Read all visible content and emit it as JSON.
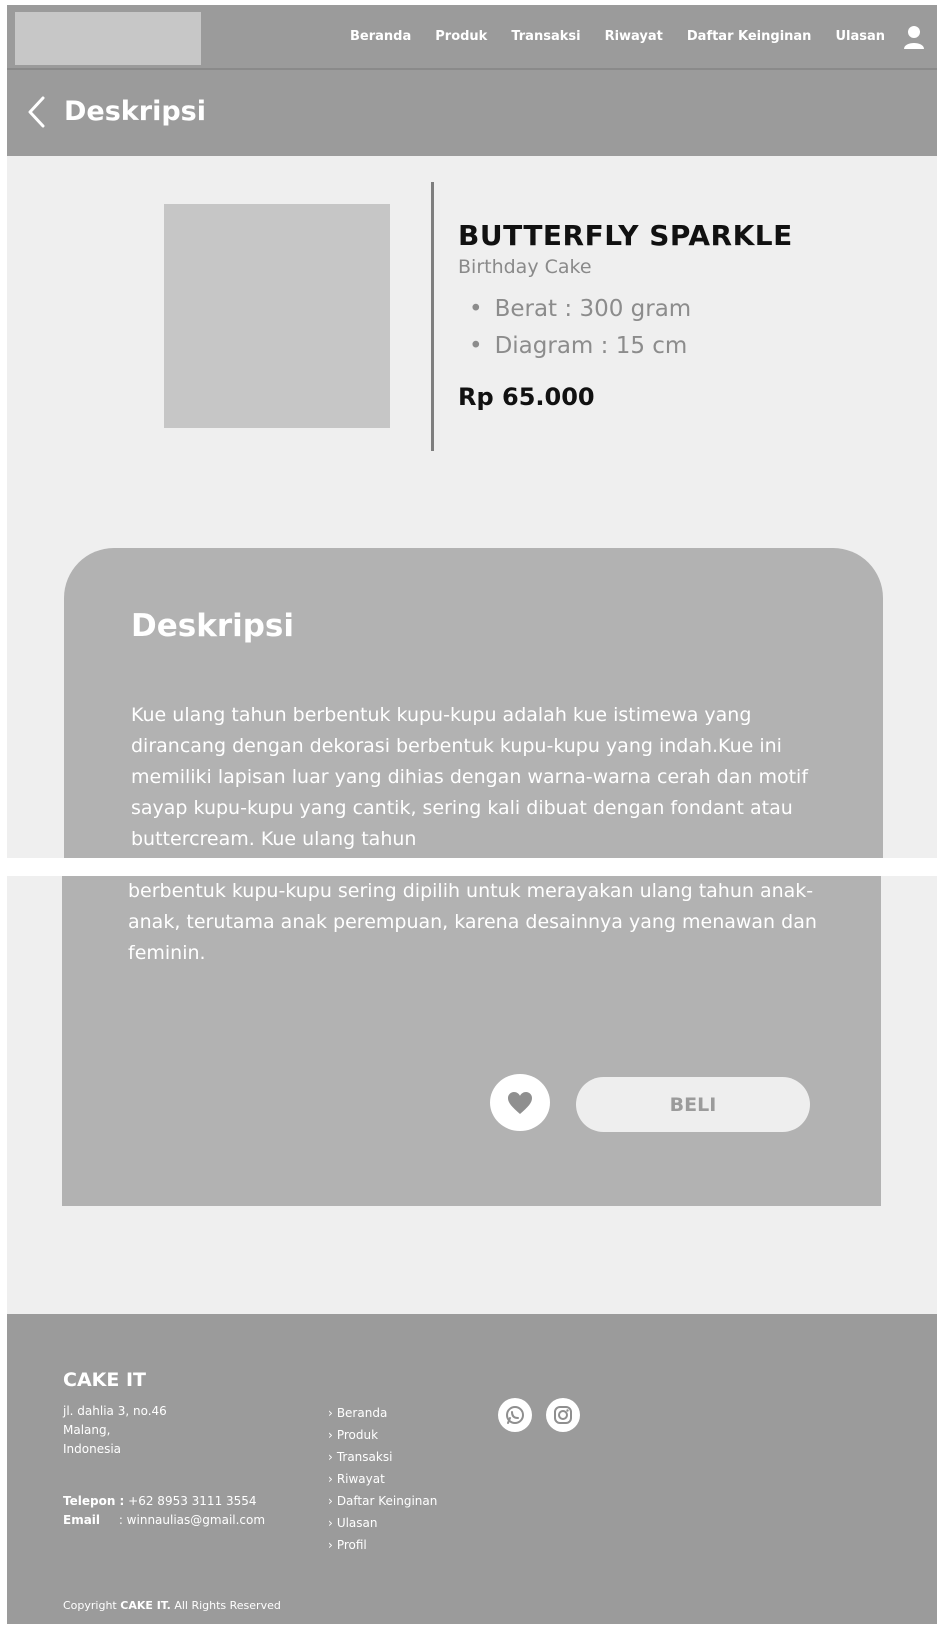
{
  "navbar": {
    "links": [
      "Beranda",
      "Produk",
      "Transaksi",
      "Riwayat",
      "Daftar Keinginan",
      "Ulasan"
    ]
  },
  "header": {
    "title": "Deskripsi"
  },
  "product": {
    "name": "BUTTERFLY SPARKLE",
    "category": "Birthday Cake",
    "specs": [
      "Berat : 300 gram",
      "Diagram : 15 cm"
    ],
    "price": "Rp 65.000"
  },
  "description": {
    "title": "Deskripsi",
    "text_part1": "Kue ulang tahun berbentuk kupu-kupu adalah kue istimewa yang dirancang dengan dekorasi berbentuk kupu-kupu yang indah.Kue ini memiliki lapisan luar yang dihias dengan warna-warna cerah dan motif sayap kupu-kupu yang cantik, sering kali dibuat dengan fondant atau buttercream. Kue ulang tahun",
    "text_part2": "berbentuk kupu-kupu sering dipilih untuk merayakan ulang tahun anak-anak, terutama anak perempuan, karena desainnya yang menawan dan feminin.",
    "buy_label": "BELI"
  },
  "footer": {
    "brand": "CAKE IT",
    "address": [
      "jl. dahlia 3, no.46",
      "Malang,",
      "Indonesia"
    ],
    "phone_label": "Telepon :",
    "phone": "+62 8953 3111 3554",
    "email_label": "Email",
    "email": ": winnaulias@gmail.com",
    "links": [
      "Beranda",
      "Produk",
      "Transaksi",
      "Riwayat",
      "Daftar Keinginan",
      "Ulasan",
      "Profil"
    ],
    "copyright_prefix": "Copyright",
    "copyright_brand": "CAKE IT.",
    "copyright_suffix": "All Rights Reserved"
  },
  "colors": {
    "bar": "#9b9b9b",
    "card": "#b2b2b2",
    "page": "#efefef"
  }
}
